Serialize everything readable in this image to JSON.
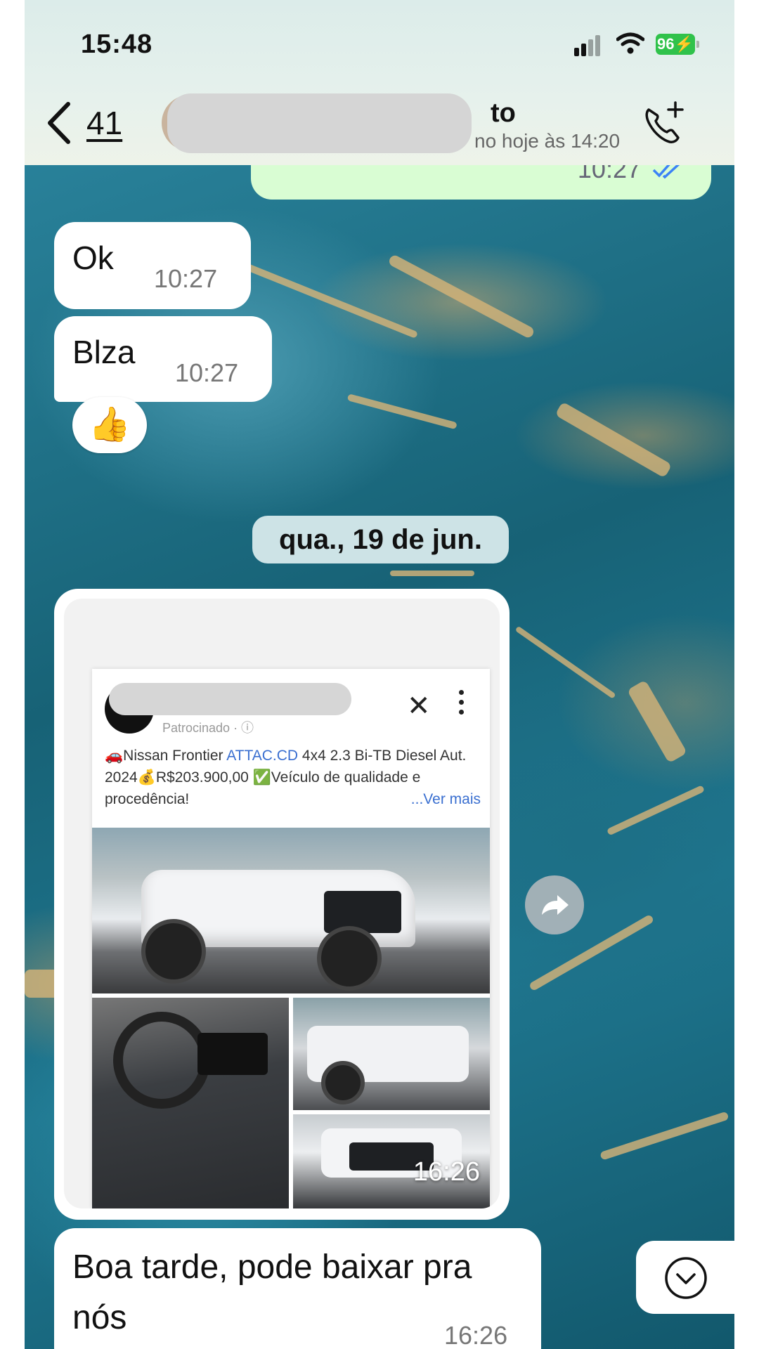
{
  "status_bar": {
    "time": "15:48",
    "battery": "96"
  },
  "header": {
    "back_count": "41",
    "contact_name_suffix": "to",
    "contact_status_suffix": "no hoje às 14:20"
  },
  "messages": [
    {
      "direction": "outgoing",
      "time": "10:27",
      "status": "read"
    },
    {
      "direction": "incoming",
      "text": "Ok",
      "time": "10:27"
    },
    {
      "direction": "incoming",
      "text": "Blza",
      "time": "10:27",
      "reaction": "👍"
    }
  ],
  "date_separator": "qua., 19 de jun.",
  "image_message": {
    "time": "16:26",
    "ad": {
      "sponsored": "Patrocinado · ⓘ",
      "text_part1": "🚗Nissan Frontier ",
      "text_highlight": "ATTAC.CD",
      "text_part2": " 4x4 2.3 Bi-TB Diesel Aut. 2024💰R$203.900,00 ✅Veículo de qualidade e procedência!",
      "see_more": "...Ver mais",
      "close_glyph": "✕"
    }
  },
  "last_message": {
    "text": "Boa tarde, pode baixar pra nós",
    "time": "16:26"
  },
  "colors": {
    "outgoing_bubble": "#d9fdd3",
    "incoming_bubble": "#ffffff",
    "read_ticks": "#3b82f6",
    "battery": "#30c24b"
  },
  "icons": [
    "back-chevron-icon",
    "call-add-icon",
    "wifi-icon",
    "signal-icon",
    "forward-icon",
    "chevron-down-icon"
  ]
}
